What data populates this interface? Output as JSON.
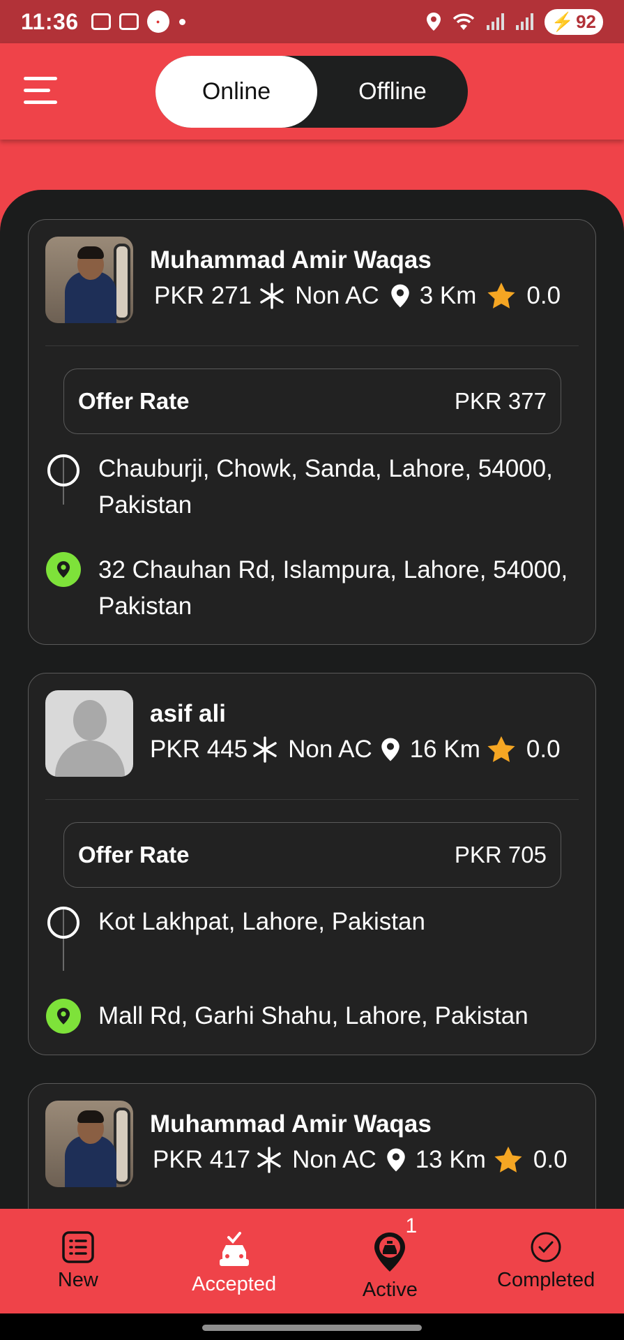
{
  "status_bar": {
    "time": "11:36",
    "battery": "92"
  },
  "header": {
    "toggle": {
      "online": "Online",
      "offline": "Offline",
      "selected": "Online"
    }
  },
  "rides": [
    {
      "name": "Muhammad Amir Waqas",
      "price": "PKR 271",
      "ac": "Non AC",
      "distance": "3 Km",
      "rating": "0.0",
      "offer_label": "Offer Rate",
      "offer_value": "PKR 377",
      "pickup": "Chauburji, Chowk, Sanda, Lahore, 54000, Pakistan",
      "dropoff": "32 Chauhan Rd, Islampura, Lahore, 54000, Pakistan",
      "avatar": "photo"
    },
    {
      "name": "asif ali",
      "price": "PKR 445",
      "ac": "Non AC",
      "distance": "16 Km",
      "rating": "0.0",
      "offer_label": "Offer Rate",
      "offer_value": "PKR 705",
      "pickup": "Kot Lakhpat, Lahore, Pakistan",
      "dropoff": "Mall Rd, Garhi Shahu, Lahore, Pakistan",
      "avatar": "placeholder"
    },
    {
      "name": "Muhammad Amir Waqas",
      "price": "PKR 417",
      "ac": "Non AC",
      "distance": "13 Km",
      "rating": "0.0",
      "avatar": "photo"
    }
  ],
  "bottom_nav": {
    "items": [
      {
        "label": "New",
        "icon": "list-icon"
      },
      {
        "label": "Accepted",
        "icon": "car-check-icon"
      },
      {
        "label": "Active",
        "icon": "taxi-pin-icon",
        "badge": "1"
      },
      {
        "label": "Completed",
        "icon": "check-circle-icon"
      }
    ]
  },
  "colors": {
    "brand": "#ef4349",
    "panel": "#1b1c1c",
    "star": "#f5a623",
    "pin": "#7ee23a"
  }
}
